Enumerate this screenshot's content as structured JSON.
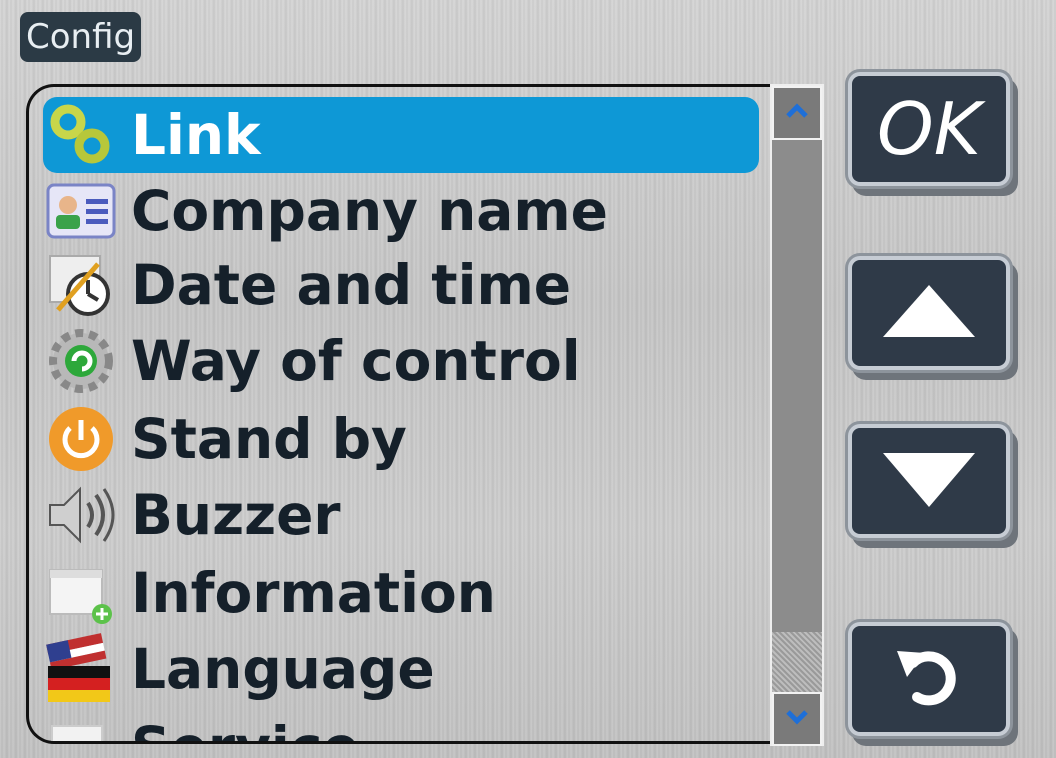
{
  "window": {
    "title": "Config"
  },
  "menu": {
    "items": [
      {
        "label": "Link",
        "icon": "link-icon",
        "selected": true
      },
      {
        "label": "Company name",
        "icon": "contact-card-icon",
        "selected": false
      },
      {
        "label": "Date and time",
        "icon": "clock-calendar-icon",
        "selected": false
      },
      {
        "label": "Way of control",
        "icon": "gear-refresh-icon",
        "selected": false
      },
      {
        "label": "Stand by",
        "icon": "power-icon",
        "selected": false
      },
      {
        "label": "Buzzer",
        "icon": "speaker-icon",
        "selected": false
      },
      {
        "label": "Information",
        "icon": "info-window-icon",
        "selected": false
      },
      {
        "label": "Language",
        "icon": "flags-icon",
        "selected": false
      },
      {
        "label": "Service",
        "icon": "service-icon",
        "selected": false
      }
    ]
  },
  "buttons": {
    "ok_label": "OK"
  },
  "colors": {
    "selection": "#0e98d6",
    "button": "#2f3a48"
  }
}
